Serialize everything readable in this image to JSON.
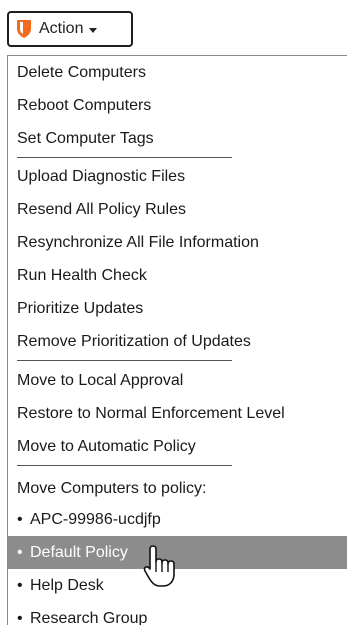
{
  "action_button": {
    "label": "Action",
    "icon": "shield-icon",
    "brand_color": "#f26a1b"
  },
  "menu": {
    "group1": [
      "Delete Computers",
      "Reboot Computers",
      "Set Computer Tags"
    ],
    "group2": [
      "Upload Diagnostic Files",
      "Resend All Policy Rules",
      "Resynchronize All File Information",
      "Run Health Check",
      "Prioritize Updates",
      "Remove Prioritization of Updates"
    ],
    "group3": [
      "Move to Local Approval",
      "Restore to Normal Enforcement Level",
      "Move to Automatic Policy"
    ],
    "policy_header": "Move Computers to policy:",
    "bullet": "•",
    "policies": [
      "APC-99986-ucdjfp",
      "Default Policy",
      "Help Desk",
      "Research Group"
    ],
    "highlighted_policy": "Default Policy",
    "highlight_color": "#8c8c8c"
  },
  "cursor": {
    "icon": "hand-pointer-icon"
  }
}
